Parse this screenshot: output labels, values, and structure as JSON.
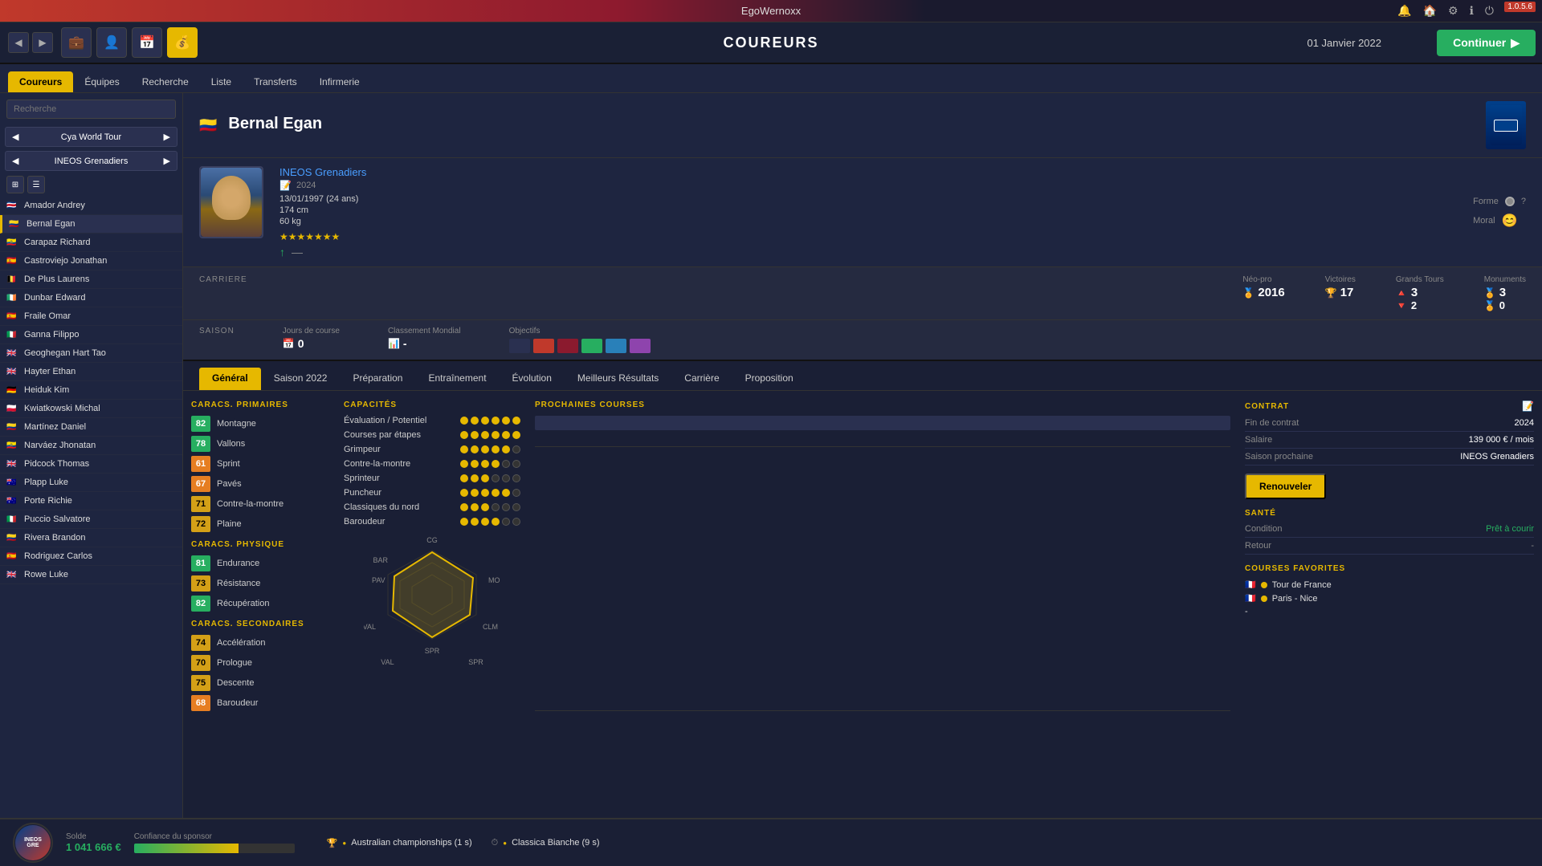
{
  "app": {
    "title": "EgoWernoxx",
    "page": "COUREURS",
    "date": "01 Janvier 2022",
    "continue_label": "Continuer",
    "version": "1.0.5.6"
  },
  "nav_tabs": [
    "Coureurs",
    "Équipes",
    "Recherche",
    "Liste",
    "Transferts",
    "Infirmerie"
  ],
  "active_nav_tab": "Coureurs",
  "sidebar": {
    "search_placeholder": "Recherche",
    "tour": "Cya World Tour",
    "team": "INEOS Grenadiers",
    "riders": [
      {
        "name": "Amador Andrey",
        "flag": "🇨🇷"
      },
      {
        "name": "Bernal Egan",
        "flag": "🇨🇴",
        "active": true
      },
      {
        "name": "Carapaz Richard",
        "flag": "🇪🇨"
      },
      {
        "name": "Castroviejo Jonathan",
        "flag": "🇪🇸"
      },
      {
        "name": "De Plus Laurens",
        "flag": "🇧🇪"
      },
      {
        "name": "Dunbar Edward",
        "flag": "🇮🇪"
      },
      {
        "name": "Fraile Omar",
        "flag": "🇪🇸"
      },
      {
        "name": "Ganna Filippo",
        "flag": "🇮🇹"
      },
      {
        "name": "Geoghegan Hart Tao",
        "flag": "🇬🇧"
      },
      {
        "name": "Hayter Ethan",
        "flag": "🇬🇧"
      },
      {
        "name": "Heiduk Kim",
        "flag": "🇩🇪"
      },
      {
        "name": "Kwiatkowski Michal",
        "flag": "🇵🇱"
      },
      {
        "name": "Martínez Daniel",
        "flag": "🇨🇴"
      },
      {
        "name": "Narváez Jhonatan",
        "flag": "🇪🇨"
      },
      {
        "name": "Pidcock Thomas",
        "flag": "🇬🇧"
      },
      {
        "name": "Plapp Luke",
        "flag": "🇦🇺"
      },
      {
        "name": "Porte Richie",
        "flag": "🇦🇺"
      },
      {
        "name": "Puccio Salvatore",
        "flag": "🇮🇹"
      },
      {
        "name": "Rivera Brandon",
        "flag": "🇨🇴"
      },
      {
        "name": "Rodriguez Carlos",
        "flag": "🇪🇸"
      },
      {
        "name": "Rowe Luke",
        "flag": "🇬🇧"
      }
    ]
  },
  "player": {
    "name": "Bernal Egan",
    "flag": "🇨🇴",
    "team": "INEOS Grenadiers",
    "contract_year": "2024",
    "dob": "13/01/1997 (24 ans)",
    "height": "174 cm",
    "weight": "60 kg",
    "form_label": "Forme",
    "moral_label": "Moral",
    "stars_count": 7
  },
  "career": {
    "label": "CARRIERE",
    "neo_pro_label": "Néo-pro",
    "neo_pro_year": "2016",
    "victories_label": "Victoires",
    "victories": "17",
    "grands_tours_label": "Grands Tours",
    "gt_gold": "3",
    "gt_silver": "2",
    "monuments_label": "Monuments",
    "mon_gold": "3",
    "mon_silver": "0"
  },
  "saison": {
    "label": "SAISON",
    "jours_label": "Jours de course",
    "jours_value": "0",
    "classement_label": "Classement Mondial",
    "classement_value": "-",
    "objectifs_label": "Objectifs"
  },
  "sub_tabs": [
    "Général",
    "Saison 2022",
    "Préparation",
    "Entraînement",
    "Évolution",
    "Meilleurs Résultats",
    "Carrière",
    "Proposition"
  ],
  "active_sub_tab": "Général",
  "primary_stats": {
    "title": "CARACS. PRIMAIRES",
    "items": [
      {
        "value": "82",
        "name": "Montagne",
        "level": "green"
      },
      {
        "value": "78",
        "name": "Vallons",
        "level": "green"
      },
      {
        "value": "61",
        "name": "Sprint",
        "level": "orange"
      },
      {
        "value": "67",
        "name": "Pavés",
        "level": "orange"
      },
      {
        "value": "71",
        "name": "Contre-la-montre",
        "level": "yellow-bg"
      },
      {
        "value": "72",
        "name": "Plaine",
        "level": "yellow-bg"
      }
    ]
  },
  "physical_stats": {
    "title": "CARACS. PHYSIQUE",
    "items": [
      {
        "value": "81",
        "name": "Endurance",
        "level": "green"
      },
      {
        "value": "73",
        "name": "Résistance",
        "level": "yellow-bg"
      },
      {
        "value": "82",
        "name": "Récupération",
        "level": "green"
      }
    ]
  },
  "secondary_stats": {
    "title": "CARACS. SECONDAIRES",
    "items": [
      {
        "value": "74",
        "name": "Accélération",
        "level": "yellow-bg"
      },
      {
        "value": "70",
        "name": "Prologue",
        "level": "yellow-bg"
      },
      {
        "value": "75",
        "name": "Descente",
        "level": "yellow-bg"
      },
      {
        "value": "68",
        "name": "Baroudeur",
        "level": "orange"
      }
    ]
  },
  "capacities": {
    "title": "CAPACITÉS",
    "items": [
      {
        "name": "Évaluation / Potentiel",
        "dots": 6,
        "filled": 6
      },
      {
        "name": "Courses par étapes",
        "dots": 6,
        "filled": 6
      },
      {
        "name": "Grimpeur",
        "dots": 6,
        "filled": 5
      },
      {
        "name": "Contre-la-montre",
        "dots": 6,
        "filled": 4
      },
      {
        "name": "Sprinteur",
        "dots": 6,
        "filled": 3
      },
      {
        "name": "Puncheur",
        "dots": 6,
        "filled": 5
      },
      {
        "name": "Classiques du nord",
        "dots": 6,
        "filled": 3
      },
      {
        "name": "Baroudeur",
        "dots": 6,
        "filled": 4
      }
    ]
  },
  "radar": {
    "labels": [
      "CG",
      "MON",
      "CLM",
      "SPR",
      "VAL",
      "PAV",
      "BAR"
    ],
    "values": [
      0.85,
      0.82,
      0.71,
      0.61,
      0.78,
      0.67,
      0.65
    ]
  },
  "upcoming_races": {
    "title": "PROCHAINES COURSES"
  },
  "contract": {
    "title": "CONTRAT",
    "fin_label": "Fin de contrat",
    "fin_value": "2024",
    "salaire_label": "Salaire",
    "salaire_value": "139 000 € / mois",
    "saison_label": "Saison prochaine",
    "saison_value": "INEOS Grenadiers",
    "renew_label": "Renouveler"
  },
  "health": {
    "title": "SANTÉ",
    "condition_label": "Condition",
    "condition_value": "Prêt à courir",
    "retour_label": "Retour",
    "retour_value": "-"
  },
  "favorites": {
    "title": "COURSES FAVORITES",
    "items": [
      {
        "flag": "🇫🇷",
        "dot_color": "#e6b800",
        "name": "Tour de France"
      },
      {
        "flag": "🇫🇷",
        "dot_color": "#e6b800",
        "name": "Paris - Nice"
      },
      {
        "name": "-"
      }
    ]
  },
  "bottom": {
    "balance_label": "Solde",
    "balance_value": "1 041 666 €",
    "sponsor_label": "Confiance du sponsor",
    "races": [
      {
        "icon": "🏆",
        "dot": "🟡",
        "text": "Australian championships (1 s)"
      },
      {
        "icon": "⏱",
        "dot": "🟡",
        "text": "Classica Bianche (9 s)"
      }
    ]
  }
}
